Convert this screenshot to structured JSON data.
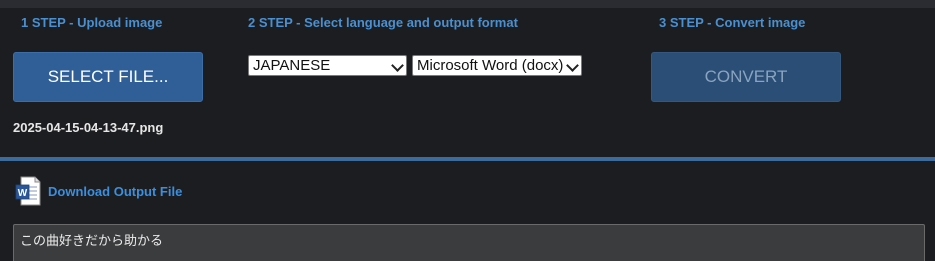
{
  "steps": {
    "step1_title": "1 STEP - Upload image",
    "step2_title": "2 STEP - Select language and output format",
    "step3_title": "3 STEP - Convert image"
  },
  "upload": {
    "select_label": "SELECT FILE...",
    "file_name": "2025-04-15-04-13-47.png"
  },
  "options": {
    "language": "JAPANESE",
    "format": "Microsoft Word (docx)"
  },
  "convert": {
    "label": "CONVERT"
  },
  "download": {
    "icon": "word-document-icon",
    "label": "Download Output File"
  },
  "output": {
    "text": "この曲好きだから助かる"
  },
  "colors": {
    "accent": "#4a90d0",
    "button": "#2f5f96",
    "button_disabled": "#2a4e75",
    "background": "#1c1d20",
    "link": "#3a8fdf"
  }
}
